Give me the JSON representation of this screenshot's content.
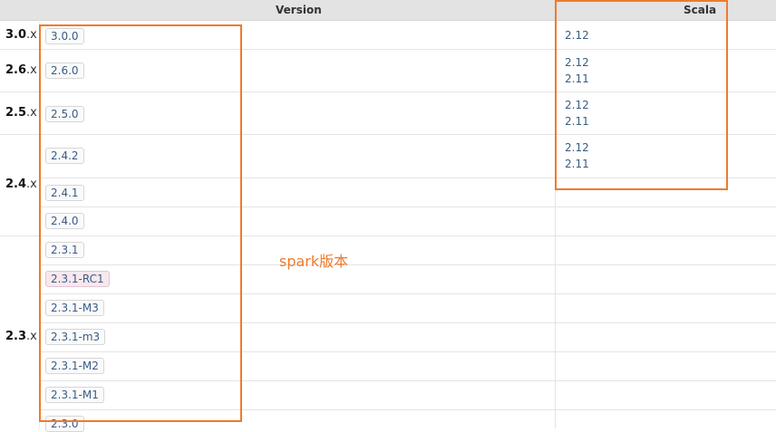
{
  "header": {
    "version_label": "Version",
    "scala_label": "Scala"
  },
  "groups": [
    {
      "major": "3.0",
      "suffix": ".x"
    },
    {
      "major": "2.6",
      "suffix": ".x"
    },
    {
      "major": "2.5",
      "suffix": ".x"
    },
    {
      "major": "2.4",
      "suffix": ".x"
    },
    {
      "major": "2.3",
      "suffix": ".x"
    }
  ],
  "versions": [
    "3.0.0",
    "2.6.0",
    "2.5.0",
    "2.4.2",
    "2.4.1",
    "2.4.0",
    "2.3.1",
    "2.3.1-RC1",
    "2.3.1-M3",
    "2.3.1-m3",
    "2.3.1-M2",
    "2.3.1-M1",
    "2.3.0"
  ],
  "scala": [
    [
      "2.12"
    ],
    [
      "2.12",
      "2.11"
    ],
    [
      "2.12",
      "2.11"
    ],
    [
      "2.12",
      "2.11"
    ]
  ],
  "annotation": {
    "label": "spark版本",
    "color": "#f07a2a"
  },
  "colors": {
    "link": "#3a5c86",
    "header_bg": "#e3e3e3",
    "rc_bg": "#f7e8ee"
  }
}
